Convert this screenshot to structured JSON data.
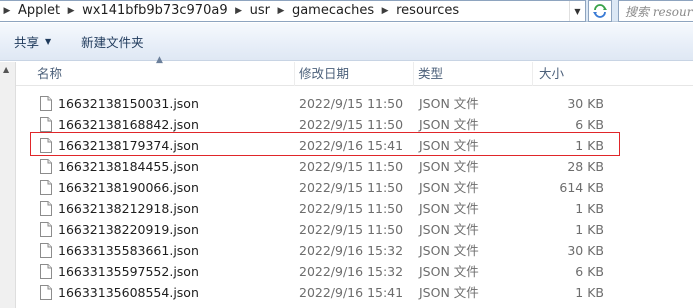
{
  "address_bar": {
    "crumbs": [
      "Applet",
      "wx141bfb9b73c970a9",
      "usr",
      "gamecaches",
      "resources"
    ],
    "separator_icon": "chevron-right-icon",
    "dropdown_icon": "chevron-down-icon",
    "refresh_icon": "refresh-icon"
  },
  "search": {
    "placeholder": "搜索 resources"
  },
  "toolbar": {
    "share_label": "共享",
    "share_arrow_icon": "chevron-down-icon",
    "new_folder_label": "新建文件夹"
  },
  "list": {
    "columns": {
      "name": "名称",
      "date": "修改日期",
      "type": "类型",
      "size": "大小"
    },
    "sort_icon": "sort-ascending-icon",
    "file_icon": "document-icon",
    "rows": [
      {
        "name": "16632138150031.json",
        "date": "2022/9/15 11:50",
        "type": "JSON 文件",
        "size": "30 KB"
      },
      {
        "name": "16632138168842.json",
        "date": "2022/9/15 11:50",
        "type": "JSON 文件",
        "size": "6 KB"
      },
      {
        "name": "16632138179374.json",
        "date": "2022/9/16 15:41",
        "type": "JSON 文件",
        "size": "1 KB"
      },
      {
        "name": "16632138184455.json",
        "date": "2022/9/15 11:50",
        "type": "JSON 文件",
        "size": "28 KB"
      },
      {
        "name": "16632138190066.json",
        "date": "2022/9/15 11:50",
        "type": "JSON 文件",
        "size": "614 KB"
      },
      {
        "name": "16632138212918.json",
        "date": "2022/9/15 11:50",
        "type": "JSON 文件",
        "size": "1 KB"
      },
      {
        "name": "16632138220919.json",
        "date": "2022/9/15 11:50",
        "type": "JSON 文件",
        "size": "1 KB"
      },
      {
        "name": "16633135583661.json",
        "date": "2022/9/16 15:32",
        "type": "JSON 文件",
        "size": "30 KB"
      },
      {
        "name": "16633135597552.json",
        "date": "2022/9/16 15:32",
        "type": "JSON 文件",
        "size": "6 KB"
      },
      {
        "name": "16633135608554.json",
        "date": "2022/9/16 15:41",
        "type": "JSON 文件",
        "size": "1 KB"
      }
    ]
  },
  "colors": {
    "highlight_border": "#e0262a",
    "toolbar_text": "#1e395b",
    "column_header_text": "#4c607a"
  }
}
